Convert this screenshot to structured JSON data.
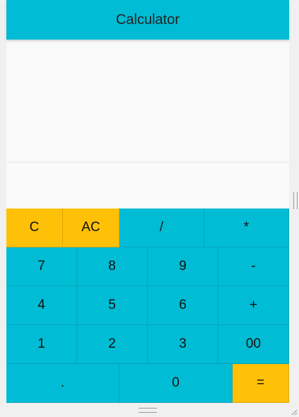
{
  "appbar": {
    "title": "Calculator"
  },
  "display": {
    "expression": "",
    "result": ""
  },
  "keys": {
    "row1": [
      "C",
      "AC",
      "/",
      "*"
    ],
    "row2": [
      "7",
      "8",
      "9",
      "-"
    ],
    "row3": [
      "4",
      "5",
      "6",
      "+"
    ],
    "row4": [
      "1",
      "2",
      "3",
      "00"
    ],
    "row5": [
      ".",
      "0",
      "="
    ]
  },
  "colors": {
    "primary": "#00bcd4",
    "accent": "#ffc107",
    "background": "#fafafa"
  }
}
